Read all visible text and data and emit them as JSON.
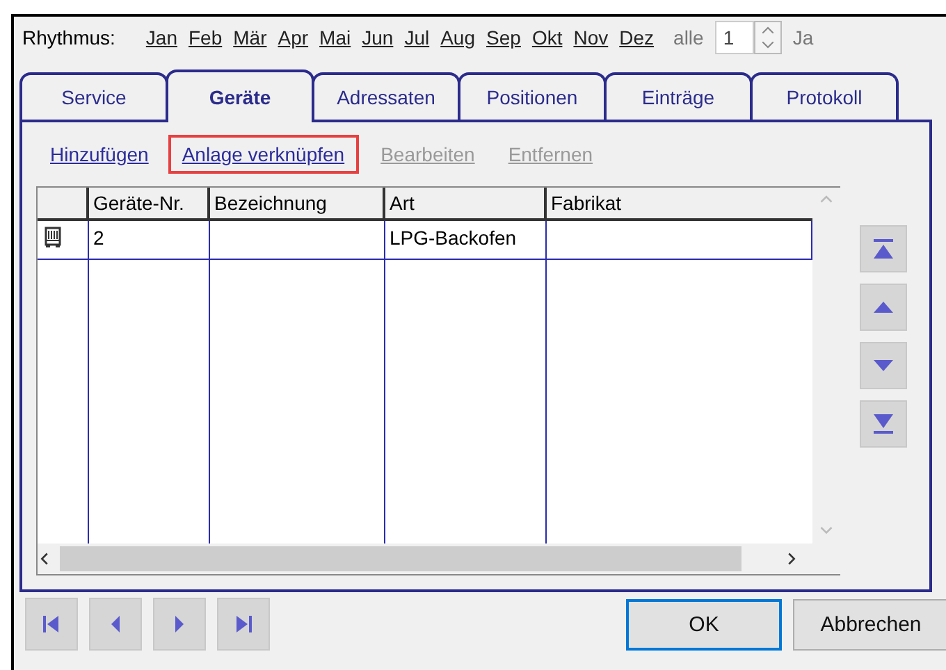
{
  "rhythm": {
    "label": "Rhythmus:",
    "months": [
      "Jan",
      "Feb",
      "Mär",
      "Apr",
      "Mai",
      "Jun",
      "Jul",
      "Aug",
      "Sep",
      "Okt",
      "Nov",
      "Dez"
    ],
    "every_label": "alle",
    "every_value": "1",
    "unit": "Ja"
  },
  "tabs": [
    {
      "label": "Service",
      "selected": false
    },
    {
      "label": "Geräte",
      "selected": true
    },
    {
      "label": "Adressaten",
      "selected": false
    },
    {
      "label": "Positionen",
      "selected": false
    },
    {
      "label": "Einträge",
      "selected": false
    },
    {
      "label": "Protokoll",
      "selected": false
    }
  ],
  "actions": [
    {
      "label": "Hinzufügen",
      "disabled": false,
      "highlighted": false
    },
    {
      "label": "Anlage verknüpfen",
      "disabled": false,
      "highlighted": true
    },
    {
      "label": "Bearbeiten",
      "disabled": true,
      "highlighted": false
    },
    {
      "label": "Entfernen",
      "disabled": true,
      "highlighted": false
    }
  ],
  "table": {
    "columns": [
      "Geräte-Nr.",
      "Bezeichnung",
      "Art",
      "Fabrikat"
    ],
    "rows": [
      {
        "cells": [
          "2",
          "",
          "LPG-Backofen",
          ""
        ]
      }
    ]
  },
  "buttons": [
    "OK",
    "Abbrechen"
  ]
}
